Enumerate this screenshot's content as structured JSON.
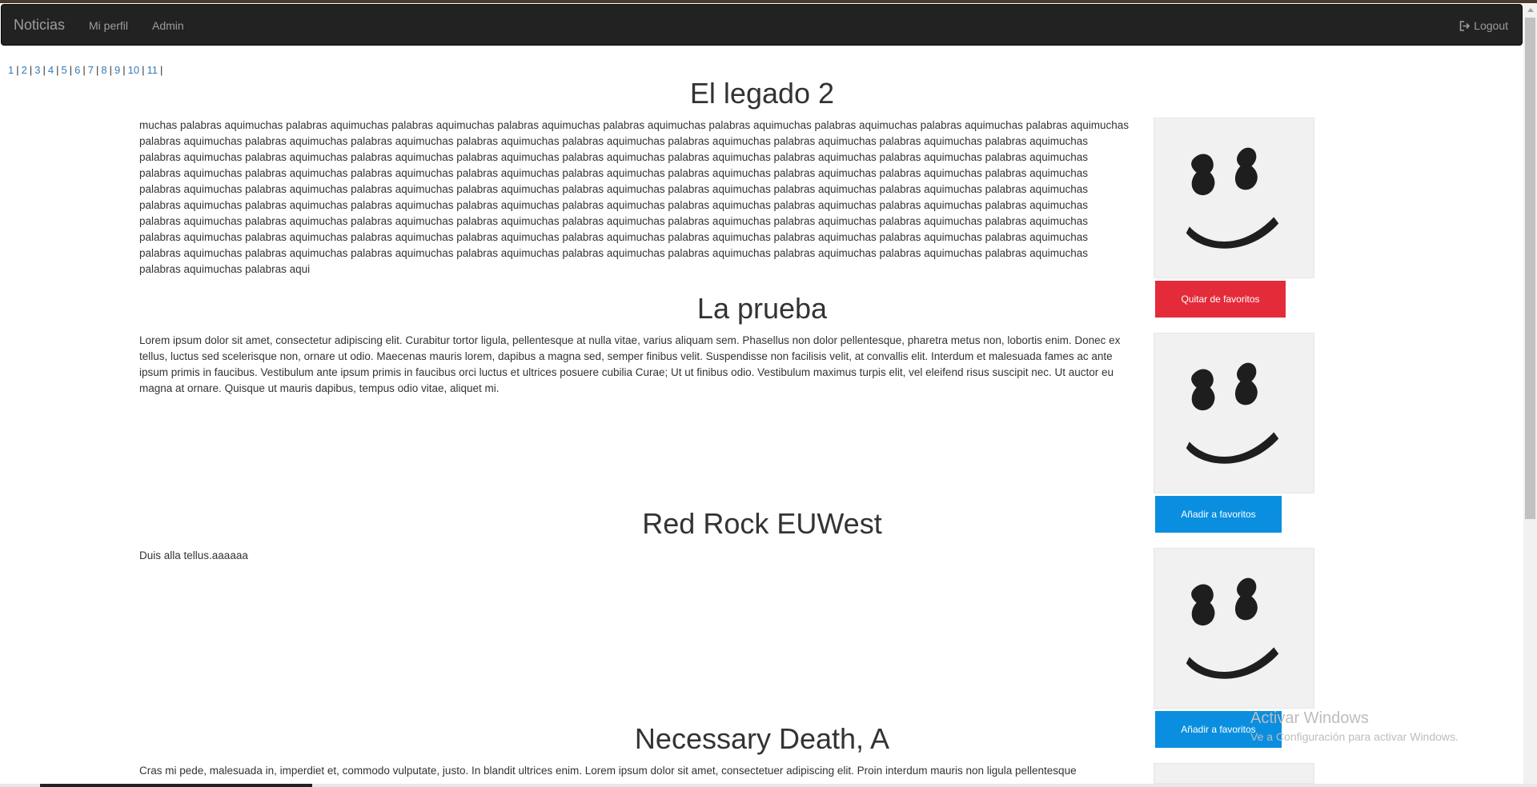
{
  "navbar": {
    "brand": "Noticias",
    "links": [
      "Mi perfil",
      "Admin"
    ],
    "logout": "Logout"
  },
  "pager": {
    "pages": [
      "1",
      "2",
      "3",
      "4",
      "5",
      "6",
      "7",
      "8",
      "9",
      "10",
      "11"
    ]
  },
  "articles": [
    {
      "title": "El legado 2",
      "body": "muchas palabras aquimuchas palabras aquimuchas palabras aquimuchas palabras aquimuchas palabras aquimuchas palabras aquimuchas palabras aquimuchas palabras aquimuchas palabras aquimuchas palabras aquimuchas palabras aquimuchas palabras aquimuchas palabras aquimuchas palabras aquimuchas palabras aquimuchas palabras aquimuchas palabras aquimuchas palabras aquimuchas palabras aquimuchas palabras aquimuchas palabras aquimuchas palabras aquimuchas palabras aquimuchas palabras aquimuchas palabras aquimuchas palabras aquimuchas palabras aquimuchas palabras aquimuchas palabras aquimuchas palabras aquimuchas palabras aquimuchas palabras aquimuchas palabras aquimuchas palabras aquimuchas palabras aquimuchas palabras aquimuchas palabras aquimuchas palabras aquimuchas palabras aquimuchas palabras aquimuchas palabras aquimuchas palabras aquimuchas palabras aquimuchas palabras aquimuchas palabras aquimuchas palabras aquimuchas palabras aquimuchas palabras aquimuchas palabras aquimuchas palabras aquimuchas palabras aquimuchas palabras aquimuchas palabras aquimuchas palabras aquimuchas palabras aquimuchas palabras aquimuchas palabras aquimuchas palabras aquimuchas palabras aquimuchas palabras aquimuchas palabras aquimuchas palabras aquimuchas palabras aquimuchas palabras aquimuchas palabras aquimuchas palabras aquimuchas palabras aquimuchas palabras aquimuchas palabras aquimuchas palabras aquimuchas palabras aquimuchas palabras aquimuchas palabras aquimuchas palabras aquimuchas palabras aquimuchas palabras aquimuchas palabras aquimuchas palabras aquimuchas palabras aquimuchas palabras aquimuchas palabras aquimuchas palabras aquimuchas palabras aqui",
      "button": "Quitar de favoritos"
    },
    {
      "title": "La prueba",
      "body": "Lorem ipsum dolor sit amet, consectetur adipiscing elit. Curabitur tortor ligula, pellentesque at nulla vitae, varius aliquam sem. Phasellus non dolor pellentesque, pharetra metus non, lobortis enim. Donec ex tellus, luctus sed scelerisque non, ornare ut odio. Maecenas mauris lorem, dapibus a magna sed, semper finibus velit. Suspendisse non facilisis velit, at convallis elit. Interdum et malesuada fames ac ante ipsum primis in faucibus. Vestibulum ante ipsum primis in faucibus orci luctus et ultrices posuere cubilia Curae; Ut ut finibus odio. Vestibulum maximus turpis elit, vel eleifend risus suscipit nec. Ut auctor eu magna at ornare. Quisque ut mauris dapibus, tempus odio vitae, aliquet mi.",
      "button": "Añadir a favoritos"
    },
    {
      "title": "Red Rock EUWest",
      "body": "Duis alla tellus.aaaaaa",
      "button": "Añadir a favoritos"
    },
    {
      "title": "Necessary Death, A",
      "body": "Cras mi pede, malesuada in, imperdiet et, commodo vulputate, justo. In blandit ultrices enim. Lorem ipsum dolor sit amet, consectetuer adipiscing elit. Proin interdum mauris non ligula pellentesque"
    }
  ],
  "watermark": {
    "line1": "Activar Windows",
    "line2": "Ve a Configuración para activar Windows."
  }
}
